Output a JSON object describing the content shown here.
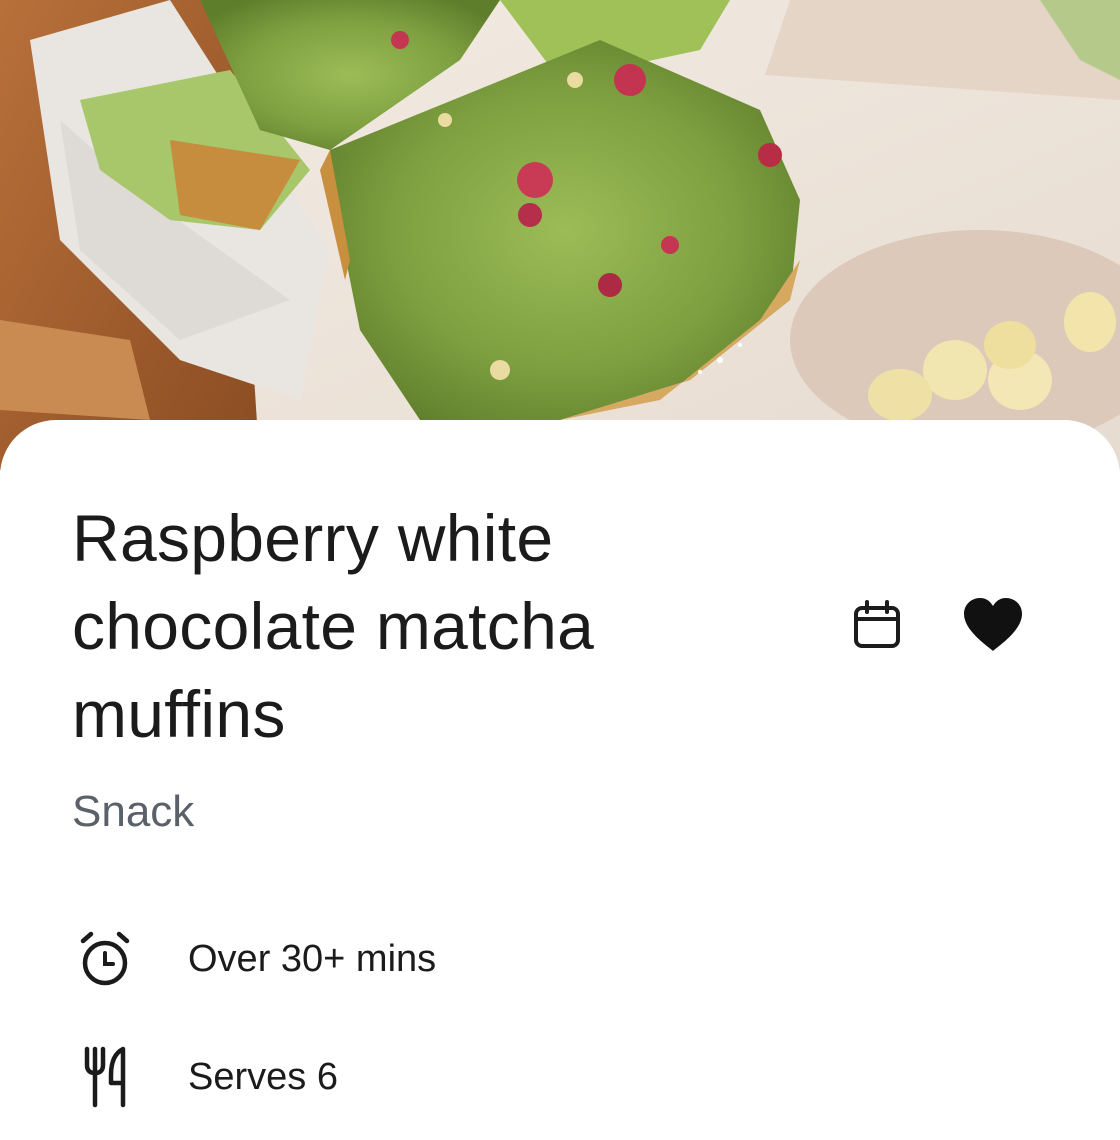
{
  "hero": {
    "image_icon": "matcha-muffins-photo"
  },
  "recipe": {
    "title": "Raspberry white chocolate matcha muffins",
    "category": "Snack"
  },
  "actions": {
    "calendar_icon": "calendar-icon",
    "favorite_icon": "heart-filled-icon"
  },
  "details": [
    {
      "icon": "alarm-clock-icon",
      "text": "Over 30+ mins"
    },
    {
      "icon": "fork-knife-icon",
      "text": "Serves 6"
    }
  ],
  "colors": {
    "text_primary": "#1b1b1b",
    "text_secondary": "#5b6169",
    "surface": "#ffffff"
  }
}
